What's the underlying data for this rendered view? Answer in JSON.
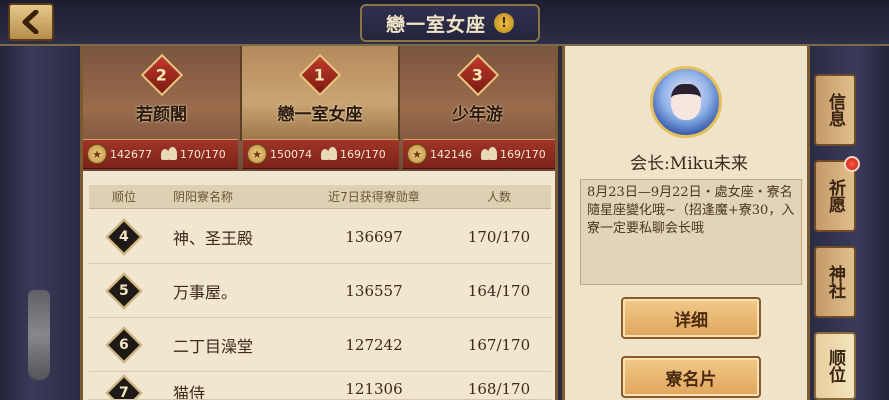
{
  "header": {
    "title": "戀一室女座",
    "warning_icon": "!"
  },
  "podium": [
    {
      "rank": "2",
      "name": "若颜閣",
      "medals": "142677",
      "members": "170/170"
    },
    {
      "rank": "1",
      "name": "戀一室女座",
      "medals": "150074",
      "members": "169/170"
    },
    {
      "rank": "3",
      "name": "少年游",
      "medals": "142146",
      "members": "169/170"
    }
  ],
  "table": {
    "headers": {
      "rank": "顺位",
      "name": "阴阳寮名称",
      "medals": "近7日获得寮勋章",
      "count": "人数"
    },
    "rows": [
      {
        "rank": "4",
        "name": "神、圣王殿",
        "medals": "136697",
        "count": "170/170"
      },
      {
        "rank": "5",
        "name": "万事屋。",
        "medals": "136557",
        "count": "164/170"
      },
      {
        "rank": "6",
        "name": "二丁目澡堂",
        "medals": "127242",
        "count": "167/170"
      },
      {
        "rank": "7",
        "name": "猫侍",
        "medals": "121306",
        "count": "168/170"
      }
    ]
  },
  "info": {
    "leader": "会长:Miku未来",
    "description": "8月23日—9月22日・處女座・寮名隨星座變化哦~（招逢魔+寮30，入寮一定要私聊会长哦",
    "detail_button": "详细",
    "card_button": "寮名片"
  },
  "side_tabs": [
    {
      "label": "信息"
    },
    {
      "label": "祈愿"
    },
    {
      "label": "神社"
    },
    {
      "label": "顺位"
    }
  ]
}
